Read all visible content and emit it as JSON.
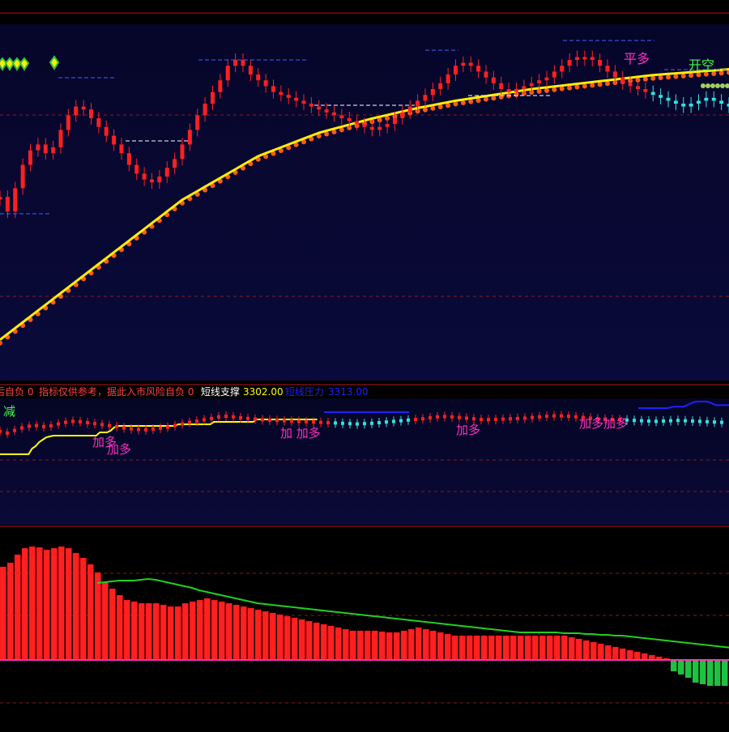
{
  "colors": {
    "up": "#ff2020",
    "down": "#33e0e0",
    "ma": "#ffee00",
    "ma_dots": "#ff5a1a",
    "grid": "#8a1a1a",
    "separator": "#b01818",
    "text_red": "#ff4040",
    "magenta": "#ff30c0",
    "green": "#40ff40",
    "blue": "#2020ff",
    "yellow": "#ffff00",
    "hist_up": "#ff2020",
    "hist_down": "#20c040",
    "signal_line": "#20d020"
  },
  "top_labels": [
    {
      "text": "平多",
      "color": "#ff30c0"
    },
    {
      "text": "开空",
      "color": "#40ff40"
    }
  ],
  "status_bar": [
    {
      "text": "后自负 0",
      "color": "#ff4040"
    },
    {
      "text": "指标仅供参考，据此入市风险自负 0",
      "color": "#ff4040"
    },
    {
      "text": "短线支撑",
      "color": "#ffffff"
    },
    {
      "text": "3302.00",
      "color": "#ffff00"
    },
    {
      "text": "短线压力",
      "color": "#2020ff"
    },
    {
      "text": "3313.00",
      "color": "#2020ff"
    }
  ],
  "mid_labels": [
    {
      "text": "减",
      "color": "#40ff40"
    },
    {
      "text": "加多",
      "color": "#ff30c0"
    },
    {
      "text": "加多",
      "color": "#ff30c0"
    },
    {
      "text": "加 加多",
      "color": "#ff30c0"
    },
    {
      "text": "加多",
      "color": "#ff30c0"
    },
    {
      "text": "加多加多",
      "color": "#ff30c0"
    }
  ],
  "chart_data": [
    {
      "type": "candlestick",
      "panel": "price",
      "series": [
        {
          "name": "price",
          "values": [
            63,
            58,
            66,
            74,
            79,
            81,
            78,
            80,
            86,
            91,
            94,
            93,
            90,
            87,
            84,
            81,
            78,
            74,
            71,
            69,
            68,
            70,
            73,
            76,
            81,
            86,
            91,
            95,
            99,
            103,
            108,
            110,
            108,
            105,
            103,
            101,
            99,
            98,
            97,
            96,
            95,
            94,
            93,
            92,
            91,
            90,
            89,
            88,
            87,
            86,
            87,
            88,
            90,
            92,
            94,
            96,
            98,
            100,
            102,
            105,
            108,
            109,
            108,
            106,
            104,
            102,
            100,
            99,
            100,
            101,
            102,
            103,
            104,
            106,
            108,
            110,
            111,
            111,
            110,
            108,
            106,
            104,
            102,
            101,
            100,
            99,
            98,
            97,
            96,
            95,
            94,
            95,
            96,
            97,
            96,
            95,
            94,
            93,
            92,
            91
          ]
        },
        {
          "name": "ma",
          "values": [
            14,
            16,
            18,
            20,
            22,
            24,
            26,
            28,
            30,
            32,
            34,
            36,
            38,
            40,
            42,
            44,
            46,
            48,
            50,
            52,
            54,
            56,
            58,
            60,
            62,
            63.5,
            65,
            66.5,
            68,
            69.5,
            71,
            72.5,
            74,
            75.5,
            77,
            78,
            79,
            80,
            81,
            82,
            83,
            84,
            85,
            85.7,
            86.4,
            87.1,
            87.8,
            88.5,
            89.2,
            89.9,
            90.5,
            91.1,
            91.7,
            92.3,
            92.9,
            93.5,
            94,
            94.5,
            95,
            95.5,
            96,
            96.4,
            96.8,
            97.2,
            97.6,
            98,
            98.4,
            98.8,
            99.2,
            99.6,
            100,
            100.3,
            100.6,
            100.9,
            101.2,
            101.5,
            101.8,
            102.1,
            102.4,
            102.7,
            103,
            103.3,
            103.6,
            103.9,
            104.2,
            104.5,
            104.8,
            105,
            105.2,
            105.4,
            105.6,
            105.8,
            106,
            106.2,
            106.4,
            106.6,
            106.8,
            107,
            107.2,
            107.4
          ]
        }
      ]
    },
    {
      "type": "candlestick",
      "panel": "short-term",
      "series": [
        {
          "name": "support",
          "values": [
            15,
            15,
            15,
            15,
            15,
            15,
            15,
            15,
            15,
            22,
            25,
            30,
            33,
            36,
            37,
            38,
            38,
            38,
            38,
            38,
            38,
            38,
            38,
            38,
            38,
            38,
            38,
            38,
            42,
            42,
            42,
            44,
            48,
            50,
            50,
            50,
            50,
            50,
            50,
            50,
            50,
            50,
            50,
            50,
            50,
            50,
            50,
            50,
            50,
            50,
            52,
            52,
            52,
            52,
            52,
            52,
            52,
            52,
            52,
            52,
            55,
            55,
            55,
            55,
            55,
            55,
            55,
            55,
            55,
            55,
            55,
            55,
            58,
            58,
            58,
            58,
            58,
            58,
            58,
            58,
            58,
            58,
            58,
            58,
            58,
            58,
            58,
            58,
            58,
            58
          ]
        },
        {
          "name": "resistance",
          "values": [
            60,
            60,
            60,
            60,
            60,
            60,
            60,
            60,
            60,
            60,
            61,
            62,
            62,
            62,
            62,
            64,
            66,
            68,
            69,
            69,
            69,
            69,
            68,
            66,
            64,
            64,
            64,
            64,
            64,
            64
          ]
        }
      ]
    },
    {
      "type": "bar",
      "panel": "histogram",
      "series": [
        {
          "name": "histogram",
          "values": [
            115,
            120,
            130,
            138,
            140,
            139,
            136,
            138,
            140,
            138,
            132,
            126,
            118,
            108,
            96,
            88,
            80,
            74,
            72,
            70,
            70,
            70,
            68,
            66,
            66,
            70,
            72,
            74,
            76,
            74,
            72,
            70,
            68,
            66,
            64,
            62,
            60,
            58,
            56,
            54,
            52,
            50,
            48,
            46,
            44,
            42,
            40,
            38,
            36,
            36,
            36,
            36,
            35,
            34,
            34,
            36,
            38,
            40,
            38,
            36,
            34,
            32,
            30,
            30,
            30,
            30,
            30,
            30,
            30,
            30,
            30,
            30,
            30,
            30,
            30,
            30,
            30,
            30,
            28,
            26,
            24,
            22,
            20,
            18,
            16,
            14,
            12,
            10,
            8,
            6,
            4,
            2,
            -14,
            -18,
            -22,
            -28,
            -30,
            -32,
            -32,
            -32
          ]
        },
        {
          "name": "signal",
          "values": [
            95,
            96,
            97,
            98,
            98,
            98,
            99,
            100,
            99,
            97,
            95,
            93,
            91,
            89,
            86,
            84,
            82,
            80,
            78,
            76,
            74,
            72,
            70,
            69,
            68,
            67,
            66,
            65,
            64,
            63,
            62,
            61,
            60,
            59,
            58,
            57,
            56,
            55,
            54,
            53,
            52,
            51,
            50,
            49,
            48,
            47,
            46,
            45,
            44,
            43,
            42,
            41,
            40,
            39,
            38,
            37,
            36,
            35,
            34,
            34,
            34,
            34,
            34,
            34,
            33,
            33,
            33,
            32,
            32,
            31,
            31,
            30,
            30,
            29,
            28,
            27,
            26,
            25,
            24,
            23,
            22,
            21,
            20,
            19,
            18,
            17,
            16,
            15
          ]
        }
      ]
    }
  ]
}
